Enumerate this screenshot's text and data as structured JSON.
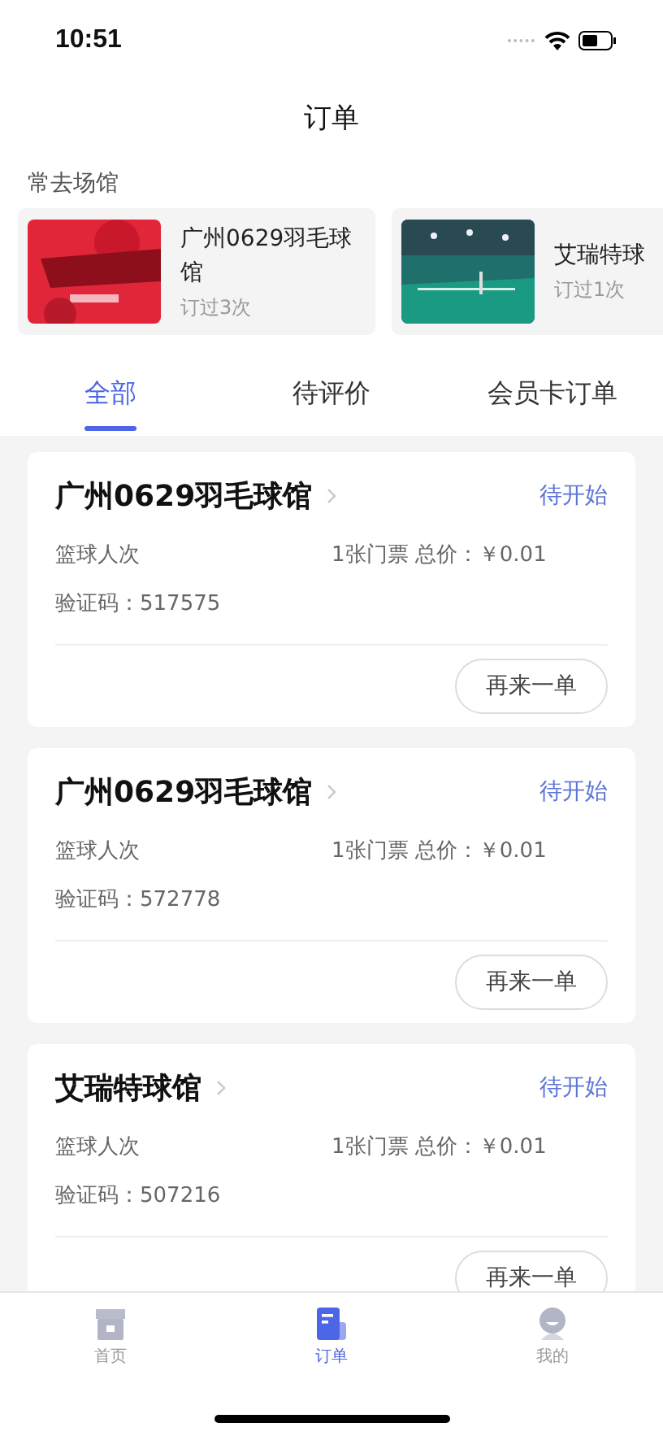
{
  "status_bar": {
    "time": "10:51"
  },
  "title": "订单",
  "frequent_venues": {
    "label": "常去场馆",
    "items": [
      {
        "name": "广州0629羽毛球馆",
        "count": "订过3次"
      },
      {
        "name": "艾瑞特球",
        "count": "订过1次"
      }
    ]
  },
  "tabs": [
    {
      "label": "全部",
      "selected": true
    },
    {
      "label": "待评价",
      "selected": false
    },
    {
      "label": "会员卡订单",
      "selected": false
    }
  ],
  "orders": [
    {
      "venue": "广州0629羽毛球馆",
      "status": "待开始",
      "item": "篮球人次",
      "summary": "1张门票 总价：￥0.01",
      "code": "验证码：517575",
      "action": "再来一单"
    },
    {
      "venue": "广州0629羽毛球馆",
      "status": "待开始",
      "item": "篮球人次",
      "summary": "1张门票 总价：￥0.01",
      "code": "验证码：572778",
      "action": "再来一单"
    },
    {
      "venue": "艾瑞特球馆",
      "status": "待开始",
      "item": "篮球人次",
      "summary": "1张门票 总价：￥0.01",
      "code": "验证码：507216",
      "action": "再来一单"
    }
  ],
  "tab_bar": [
    {
      "label": "首页",
      "kind": "home",
      "selected": false
    },
    {
      "label": "订单",
      "kind": "orders",
      "selected": true
    },
    {
      "label": "我的",
      "kind": "profile",
      "selected": false
    }
  ]
}
